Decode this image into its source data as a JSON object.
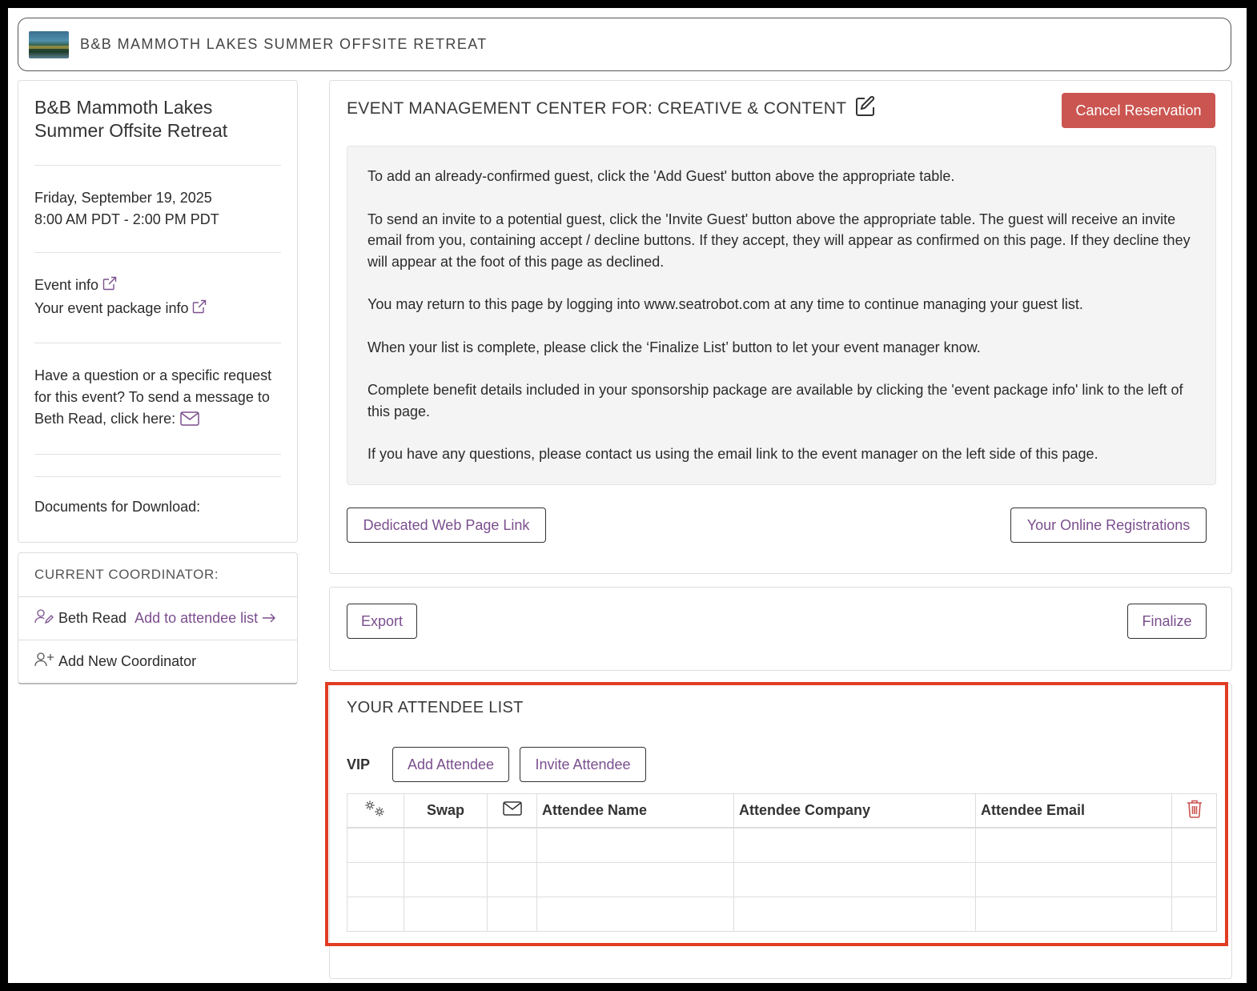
{
  "header": {
    "title": "B&B MAMMOTH LAKES SUMMER OFFSITE RETREAT"
  },
  "sidebar": {
    "event_title": "B&B Mammoth Lakes Summer Offsite Retreat",
    "date": "Friday, September 19, 2025",
    "time": "8:00 AM PDT - 2:00 PM PDT",
    "event_info_link": "Event info",
    "package_info_link": "Your event package info",
    "question_text": "Have a question or a specific request for this event? To send a message to Beth Read, click here:",
    "documents_label": "Documents for Download:"
  },
  "coordinator": {
    "heading": "CURRENT COORDINATOR:",
    "name": "Beth Read",
    "add_link": "Add to attendee list",
    "add_new": "Add New Coordinator"
  },
  "main": {
    "heading": "EVENT MANAGEMENT CENTER FOR: CREATIVE & CONTENT",
    "cancel_button": "Cancel Reservation",
    "instructions": [
      "To add an already-confirmed guest, click the 'Add Guest' button above the appropriate table.",
      "To send an invite to a potential guest, click the 'Invite Guest' button above the appropriate table. The guest will receive an invite email from you, containing accept / decline buttons. If they accept, they will appear as confirmed on this page. If they decline they will appear at the foot of this page as declined.",
      "You may return to this page by logging into www.seatrobot.com at any time to continue managing your guest list.",
      "When your list is complete, please click the ‘Finalize List’ button to let your event manager know.",
      "Complete benefit details included in your sponsorship package are available by clicking the 'event package info' link to the left of this page.",
      "If you have any questions, please contact us using the email link to the event manager on the left side of this page."
    ],
    "web_page_button": "Dedicated Web Page Link",
    "registrations_button": "Your Online Registrations"
  },
  "actions": {
    "export_button": "Export",
    "finalize_button": "Finalize"
  },
  "attendees": {
    "heading": "YOUR ATTENDEE LIST",
    "group_label": "VIP",
    "add_button": "Add Attendee",
    "invite_button": "Invite Attendee",
    "columns": {
      "settings_icon": "gears-icon",
      "swap": "Swap",
      "email_icon": "envelope-icon",
      "name": "Attendee Name",
      "company": "Attendee Company",
      "email": "Attendee Email",
      "delete_icon": "trash-icon"
    },
    "empty_rows": 3
  },
  "colors": {
    "accent_purple": "#7b4f8e",
    "cancel_red": "#cb5550",
    "highlight_red": "#e03c23",
    "info_bg": "#f4f4f4"
  }
}
